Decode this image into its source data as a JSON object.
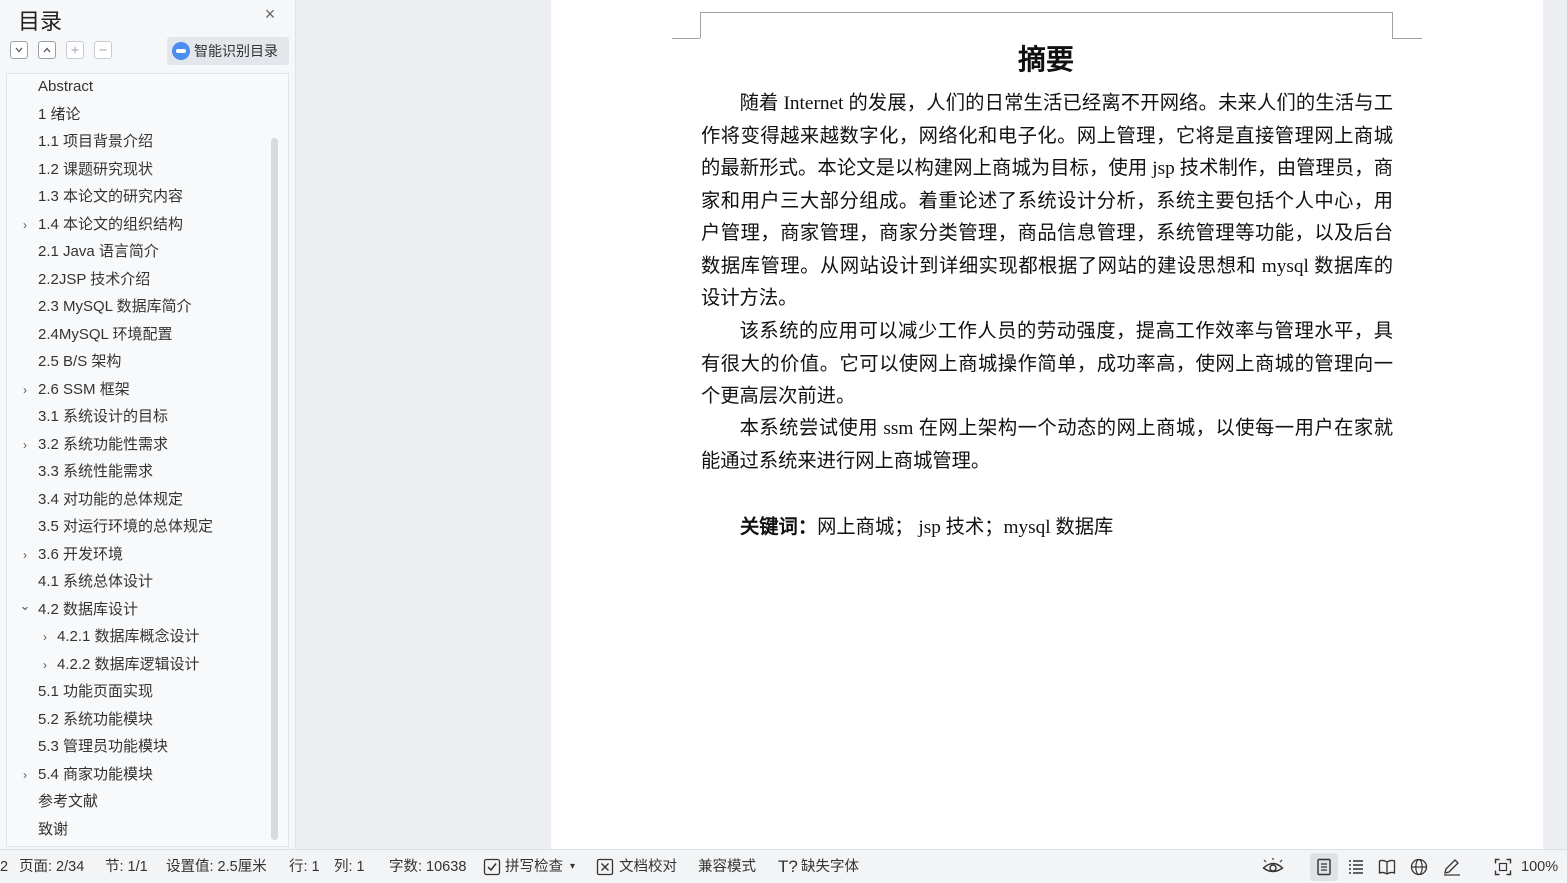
{
  "sidebar": {
    "title": "目录",
    "close_icon": "×",
    "smart_label": "智能识别目录",
    "toc": [
      {
        "label": "Abstract",
        "chev": ""
      },
      {
        "label": "1 绪论",
        "chev": ""
      },
      {
        "label": "1.1 项目背景介绍",
        "chev": ""
      },
      {
        "label": "1.2 课题研究现状",
        "chev": ""
      },
      {
        "label": "1.3 本论文的研究内容",
        "chev": ""
      },
      {
        "label": "1.4 本论文的组织结构",
        "chev": "›"
      },
      {
        "label": "2.1 Java 语言简介",
        "chev": ""
      },
      {
        "label": "2.2JSP 技术介绍",
        "chev": ""
      },
      {
        "label": "2.3 MySQL 数据库简介",
        "chev": ""
      },
      {
        "label": "2.4MySQL 环境配置",
        "chev": ""
      },
      {
        "label": "2.5 B/S 架构",
        "chev": ""
      },
      {
        "label": "2.6 SSM 框架",
        "chev": "›"
      },
      {
        "label": "3.1 系统设计的目标",
        "chev": ""
      },
      {
        "label": "3.2 系统功能性需求",
        "chev": "›"
      },
      {
        "label": "3.3 系统性能需求",
        "chev": ""
      },
      {
        "label": "3.4 对功能的总体规定",
        "chev": ""
      },
      {
        "label": "3.5 对运行环境的总体规定",
        "chev": ""
      },
      {
        "label": "3.6 开发环境",
        "chev": "›"
      },
      {
        "label": "4.1 系统总体设计",
        "chev": ""
      },
      {
        "label": "4.2 数据库设计",
        "chev": "⌄"
      },
      {
        "label": "4.2.1  数据库概念设计",
        "chev": "›",
        "sub": true
      },
      {
        "label": "4.2.2  数据库逻辑设计",
        "chev": "›",
        "sub": true
      },
      {
        "label": "5.1 功能页面实现",
        "chev": ""
      },
      {
        "label": "5.2 系统功能模块",
        "chev": ""
      },
      {
        "label": "5.3 管理员功能模块",
        "chev": ""
      },
      {
        "label": "5.4 商家功能模块",
        "chev": "›"
      },
      {
        "label": "参考文献",
        "chev": ""
      },
      {
        "label": "致谢",
        "chev": ""
      }
    ]
  },
  "document": {
    "title": "摘要",
    "p1": "随着 Internet 的发展，人们的日常生活已经离不开网络。未来人们的生活与工作将变得越来越数字化，网络化和电子化。网上管理，它将是直接管理网上商城的最新形式。本论文是以构建网上商城为目标，使用 jsp 技术制作，由管理员，商家和用户三大部分组成。着重论述了系统设计分析，系统主要包括个人中心，用户管理，商家管理，商家分类管理，商品信息管理，系统管理等功能，以及后台数据库管理。从网站设计到详细实现都根据了网站的建设思想和 mysql 数据库的设计方法。",
    "p2": "该系统的应用可以减少工作人员的劳动强度，提高工作效率与管理水平，具有很大的价值。它可以使网上商城操作简单，成功率高，使网上商城的管理向一个更高层次前进。",
    "p3": "本系统尝试使用 ssm 在网上架构一个动态的网上商城，以使每一用户在家就能通过系统来进行网上商城管理。",
    "keywords_label": "关键词：",
    "keywords_value": "网上商城；  jsp 技术；mysql 数据库"
  },
  "statusbar": {
    "left_cut": "2",
    "page": "页面: 2/34",
    "section": "节: 1/1",
    "setting": "设置值: 2.5厘米",
    "row": "行: 1",
    "col": "列: 1",
    "wordcount": "字数: 10638",
    "spell": "拼写检查",
    "proof": "文档校对",
    "compat": "兼容模式",
    "missing_font": "缺失字体",
    "zoom": "100%"
  }
}
